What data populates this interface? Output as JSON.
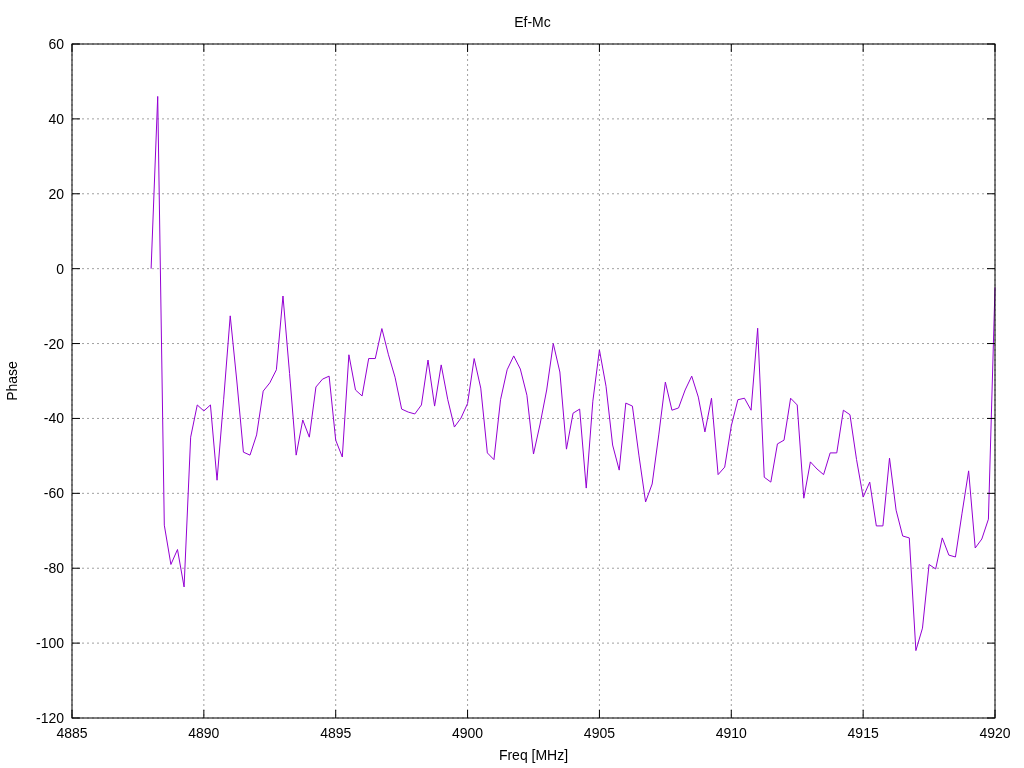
{
  "chart": {
    "chart_data": {
      "type": "line",
      "grid": true,
      "title": "Ef-Mc",
      "xlabel": "Freq [MHz]",
      "ylabel": "Phase",
      "xlim": [
        4885,
        4920
      ],
      "ylim": [
        -120,
        60
      ],
      "xticks": [
        4885,
        4890,
        4895,
        4900,
        4905,
        4910,
        4915,
        4920
      ],
      "yticks": [
        -120,
        -100,
        -80,
        -60,
        -40,
        -20,
        0,
        20,
        40,
        60
      ],
      "x": [
        4888,
        4888.25,
        4888.5,
        4888.75,
        4889,
        4889.25,
        4889.5,
        4889.75,
        4890,
        4890.25,
        4890.5,
        4890.75,
        4891,
        4891.25,
        4891.5,
        4891.75,
        4892,
        4892.25,
        4892.5,
        4892.75,
        4893,
        4893.25,
        4893.5,
        4893.75,
        4894,
        4894.25,
        4894.5,
        4894.75,
        4895,
        4895.25,
        4895.5,
        4895.75,
        4896,
        4896.25,
        4896.5,
        4896.75,
        4897,
        4897.25,
        4897.5,
        4897.75,
        4898,
        4898.25,
        4898.5,
        4898.75,
        4899,
        4899.25,
        4899.5,
        4899.75,
        4900,
        4900.25,
        4900.5,
        4900.75,
        4901,
        4901.25,
        4901.5,
        4901.75,
        4902,
        4902.25,
        4902.5,
        4902.75,
        4903,
        4903.25,
        4903.5,
        4903.75,
        4904,
        4904.25,
        4904.5,
        4904.75,
        4905,
        4905.25,
        4905.5,
        4905.75,
        4906,
        4906.25,
        4906.5,
        4906.75,
        4907,
        4907.25,
        4907.5,
        4907.75,
        4908,
        4908.25,
        4908.5,
        4908.75,
        4909,
        4909.25,
        4909.5,
        4909.75,
        4910,
        4910.25,
        4910.5,
        4910.75,
        4911,
        4911.25,
        4911.5,
        4911.75,
        4912,
        4912.25,
        4912.5,
        4912.75,
        4913,
        4913.25,
        4913.5,
        4913.75,
        4914,
        4914.25,
        4914.5,
        4914.75,
        4915,
        4915.25,
        4915.5,
        4915.75,
        4916,
        4916.25,
        4916.5,
        4916.75,
        4917,
        4917.25,
        4917.5,
        4917.75,
        4918,
        4918.25,
        4918.5,
        4918.75,
        4919,
        4919.25,
        4919.5,
        4919.75,
        4920
      ],
      "series": [
        {
          "color": "#9400d3",
          "values": [
            0,
            46,
            -68.5,
            -79,
            -75,
            -85,
            -45,
            -36.4,
            -38,
            -36.4,
            -56.5,
            -35,
            -12.6,
            -30,
            -49,
            -49.8,
            -44.4,
            -32.7,
            -30.5,
            -27,
            -7.3,
            -28,
            -49.8,
            -40.4,
            -45,
            -31.6,
            -29.5,
            -28.7,
            -45.8,
            -50.3,
            -23,
            -32.4,
            -34,
            -24,
            -24,
            -16,
            -23,
            -29,
            -37.5,
            -38.3,
            -38.8,
            -36.4,
            -24.4,
            -36.7,
            -25.7,
            -35,
            -42.3,
            -39.9,
            -36,
            -24,
            -31.9,
            -49.2,
            -51,
            -35,
            -27,
            -23.3,
            -26.8,
            -33.8,
            -49.5,
            -41.5,
            -32.4,
            -20,
            -27.6,
            -48.2,
            -38.6,
            -37.5,
            -58.6,
            -35.4,
            -21.7,
            -31.4,
            -47.1,
            -53.8,
            -35.9,
            -36.7,
            -50,
            -62.3,
            -57.5,
            -44.4,
            -30.3,
            -37.8,
            -37.2,
            -32.4,
            -28.7,
            -34.3,
            -43.6,
            -34.6,
            -55,
            -53,
            -42,
            -35,
            -34.6,
            -37.8,
            -15.9,
            -55.7,
            -57,
            -46.8,
            -45.8,
            -34.6,
            -36.4,
            -61.3,
            -51.6,
            -53.5,
            -55,
            -49.2,
            -49.2,
            -37.8,
            -39,
            -51,
            -61,
            -57,
            -68.7,
            -68.7,
            -50.6,
            -64.5,
            -71.4,
            -71.9,
            -102,
            -96,
            -79,
            -80.2,
            -71.9,
            -76.5,
            -77,
            -65.3,
            -54,
            -74.6,
            -72.2,
            -66.9,
            -5
          ]
        }
      ]
    }
  }
}
